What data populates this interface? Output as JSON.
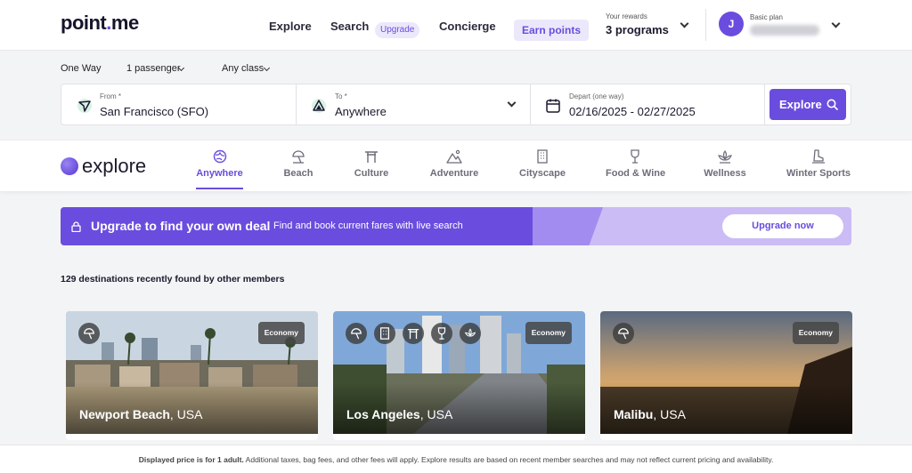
{
  "brand": {
    "logo_main": "point",
    "logo_dot": ".",
    "logo_end": "me"
  },
  "header": {
    "nav": {
      "explore": "Explore",
      "search": "Search",
      "concierge": "Concierge"
    },
    "upgrade_pill": "Upgrade",
    "earn_points": "Earn points",
    "rewards_caption": "Your rewards",
    "rewards_value": "3 programs",
    "avatar_initial": "J",
    "plan_caption": "Basic plan"
  },
  "search": {
    "trip_type": "One Way",
    "passengers": "1 passenger",
    "cabin": "Any class",
    "from_label": "From *",
    "from_value": "San Francisco (SFO)",
    "to_label": "To *",
    "to_value": "Anywhere",
    "depart_label": "Depart (one way)",
    "depart_value": "02/16/2025 - 02/27/2025",
    "explore_button": "Explore"
  },
  "categories": {
    "title": "explore",
    "items": [
      {
        "label": "Anywhere",
        "icon": "globe-icon",
        "active": true
      },
      {
        "label": "Beach",
        "icon": "beach-umbrella-icon"
      },
      {
        "label": "Culture",
        "icon": "torii-gate-icon"
      },
      {
        "label": "Adventure",
        "icon": "mountain-icon"
      },
      {
        "label": "Cityscape",
        "icon": "building-icon"
      },
      {
        "label": "Food & Wine",
        "icon": "wine-glass-icon"
      },
      {
        "label": "Wellness",
        "icon": "lotus-icon"
      },
      {
        "label": "Winter Sports",
        "icon": "ski-boot-icon"
      }
    ]
  },
  "banner": {
    "title": "Upgrade to find your own deal",
    "subtitle": "Find and book current fares with live search",
    "button": "Upgrade now"
  },
  "results": {
    "count_text": "129 destinations recently found by other members",
    "cards": [
      {
        "city": "Newport Beach",
        "country": ", USA",
        "cabin": "Economy"
      },
      {
        "city": "Los Angeles",
        "country": ", USA",
        "cabin": "Economy"
      },
      {
        "city": "Malibu",
        "country": ", USA",
        "cabin": "Economy"
      }
    ]
  },
  "footer": {
    "bold": "Displayed price is for 1 adult.",
    "rest": " Additional taxes, bag fees, and other fees will apply. Explore results are based on recent member searches and may not reflect current pricing and availability."
  },
  "colors": {
    "accent": "#6a4dde",
    "accent_light": "#ece8fb"
  }
}
